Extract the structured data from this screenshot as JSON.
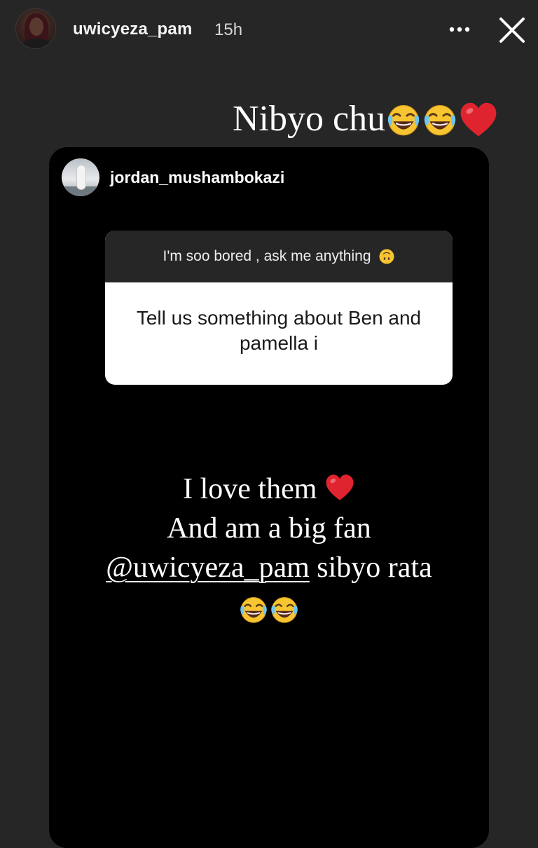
{
  "header": {
    "username": "uwicyeza_pam",
    "time": "15h"
  },
  "caption": {
    "text": "Nibyo chu",
    "emojis": [
      "face-with-tears-of-joy",
      "face-with-tears-of-joy",
      "red-heart"
    ]
  },
  "shared_post": {
    "username": "jordan_mushambokazi",
    "question_prompt": "I'm soo bored , ask me anything",
    "prompt_emoji": "upside-down-face",
    "question": "Tell us something about Ben and pamella i",
    "answer": {
      "line1": "I love them",
      "line2": "And am a big fan",
      "mention": "@uwicyeza_pam",
      "line3_rest": " sibyo rata",
      "emojis": [
        "red-heart",
        "face-with-tears-of-joy",
        "face-with-tears-of-joy"
      ]
    }
  },
  "colors": {
    "background": "#262626",
    "card": "#000000",
    "heart": "#e0242f",
    "emoji_yellow": "#f7c531"
  }
}
